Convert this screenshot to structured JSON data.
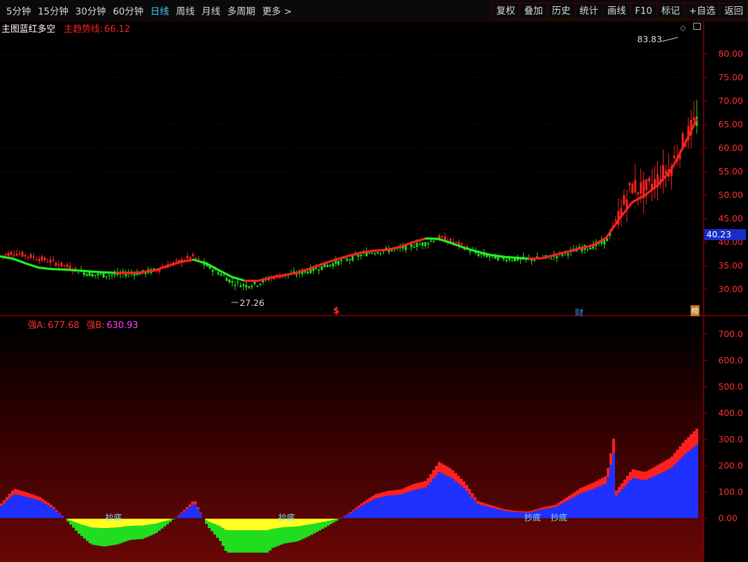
{
  "toolbar": {
    "periods": [
      "5分钟",
      "15分钟",
      "30分钟",
      "60分钟",
      "日线",
      "周线",
      "月线",
      "多周期",
      "更多 >"
    ],
    "active_period": "日线",
    "actions": [
      "复权",
      "叠加",
      "历史",
      "统计",
      "画线",
      "F10",
      "标记",
      "+自选",
      "返回"
    ]
  },
  "main_chart": {
    "indicator_name": "主图蓝红多空",
    "trend_label": "主趋势线:",
    "trend_value": "66.12",
    "high_label": "83.83",
    "low_label": "27.26",
    "current_price": "40.23",
    "y_ticks": [
      "80.00",
      "75.00",
      "70.00",
      "65.00",
      "60.00",
      "55.00",
      "50.00",
      "45.00",
      "40.00",
      "35.00",
      "30.00"
    ],
    "markers": [
      "$",
      "财",
      "榜"
    ],
    "colors": {
      "up": "#ff2222",
      "down": "#22dd22",
      "trend_up": "#ff2020",
      "trend_down": "#22ee22"
    }
  },
  "sub_chart": {
    "a_label": "强A:",
    "a_value": "677.68",
    "b_label": "强B:",
    "b_value": "630.93",
    "y_ticks": [
      "700.0",
      "600.0",
      "500.0",
      "400.0",
      "300.0",
      "200.0",
      "100.0",
      "0.00"
    ],
    "bottom_labels": [
      "抄底",
      "抄底",
      "抄底",
      "抄底"
    ],
    "colors": {
      "a": "#ff2020",
      "b": "#2030ff",
      "neg": "#ffff20",
      "neg_green": "#20dd20"
    }
  },
  "chart_data": {
    "type": "line",
    "title": "",
    "ylabel": "",
    "ylim": [
      27,
      84
    ],
    "series": [
      {
        "values": [
          37.0,
          37.8,
          37.2,
          36.6,
          35.9,
          35.0,
          34.0,
          33.2,
          33.0,
          33.1,
          33.4,
          33.5,
          34.0,
          35.0,
          36.0,
          37.0,
          35.0,
          33.5,
          31.5,
          30.8,
          31.2,
          32.5,
          33.0,
          33.3,
          34.0,
          34.8,
          35.6,
          36.4,
          37.3,
          38.0,
          38.3,
          38.6,
          39.3,
          39.8,
          41.0,
          40.2,
          39.0,
          37.5,
          37.0,
          36.6,
          36.4,
          36.3,
          36.6,
          37.0,
          37.8,
          38.6,
          39.2,
          40.2,
          46.0,
          52.0,
          51.0,
          53.5,
          56.0,
          61.5,
          66.0
        ]
      },
      {
        "values": [
          37.0,
          36.5,
          35.5,
          34.6,
          34.3,
          34.2,
          34.0,
          33.8,
          33.6,
          33.5,
          33.5,
          33.6,
          34.0,
          35.0,
          35.8,
          36.3,
          35.5,
          34.0,
          32.6,
          31.8,
          31.8,
          32.5,
          33.0,
          33.5,
          34.4,
          35.4,
          36.3,
          37.1,
          37.8,
          38.2,
          38.4,
          39.0,
          40.0,
          40.8,
          40.7,
          39.8,
          38.8,
          38.0,
          37.3,
          36.9,
          36.7,
          36.5,
          36.6,
          37.3,
          38.0,
          38.7,
          39.4,
          41.0,
          45.0,
          48.5,
          50.0,
          52.2,
          55.3,
          60.5,
          66.1
        ]
      }
    ]
  }
}
